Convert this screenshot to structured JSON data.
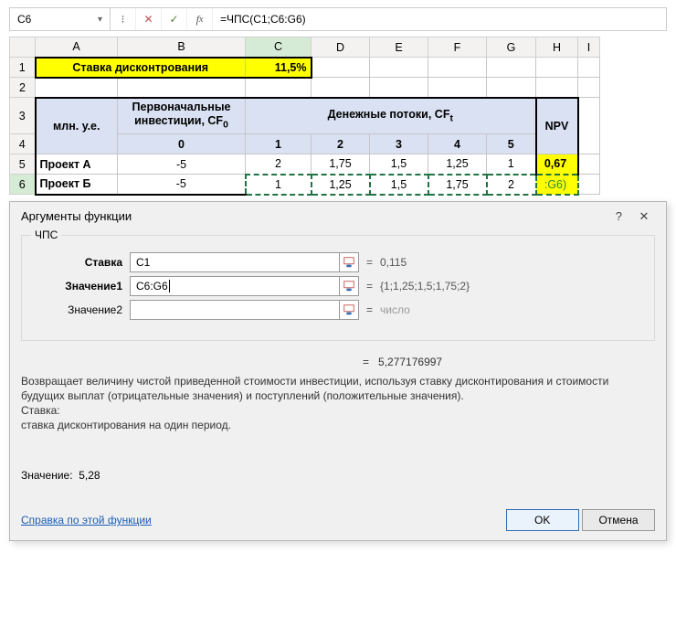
{
  "formulaBar": {
    "nameBox": "C6",
    "formula": "=ЧПС(C1;C6:G6)"
  },
  "columns": [
    "A",
    "B",
    "C",
    "D",
    "E",
    "F",
    "G",
    "H",
    "I"
  ],
  "rows": [
    "1",
    "2",
    "3",
    "4",
    "5",
    "6"
  ],
  "cells": {
    "A1B1": "Ставка дисконтрования",
    "C1": "11,5%",
    "A3": "млн. у.е.",
    "B3_top": "Первоначальные",
    "B3_bot": "инвестиции, CF",
    "B3_sub": "0",
    "CG3": "Денежные потоки, CF",
    "CG3_sub": "t",
    "H3": "NPV",
    "B4": "0",
    "C4": "1",
    "D4": "2",
    "E4": "3",
    "F4": "4",
    "G4": "5",
    "A5": "Проект А",
    "B5": "-5",
    "C5": "2",
    "D5": "1,75",
    "E5": "1,5",
    "F5": "1,25",
    "G5": "1",
    "H5": "0,67",
    "A6": "Проект Б",
    "B6": "-5",
    "C6": "1",
    "D6": "1,25",
    "E6": "1,5",
    "F6": "1,75",
    "G6": "2",
    "H6": ":G6)"
  },
  "dialog": {
    "title": "Аргументы функции",
    "func": "ЧПС",
    "fields": [
      {
        "label": "Ставка",
        "value": "C1",
        "bold": true,
        "result": "0,115"
      },
      {
        "label": "Значение1",
        "value": "C6:G6",
        "bold": true,
        "result": "{1;1,25;1,5;1,75;2}"
      },
      {
        "label": "Значение2",
        "value": "",
        "bold": false,
        "result": "число",
        "placeholder": true
      }
    ],
    "resultEq": "=",
    "resultVal": "5,277176997",
    "description": "Возвращает величину чистой приведенной стоимости инвестиции, используя ставку дисконтирования и стоимости будущих выплат (отрицательные значения) и поступлений (положительные значения).",
    "paramName": "Ставка:",
    "paramDesc": "ставка дисконтирования на один период.",
    "valueLabel": "Значение:",
    "valueShort": "5,28",
    "helpLink": "Справка по этой функции",
    "ok": "OK",
    "cancel": "Отмена"
  }
}
